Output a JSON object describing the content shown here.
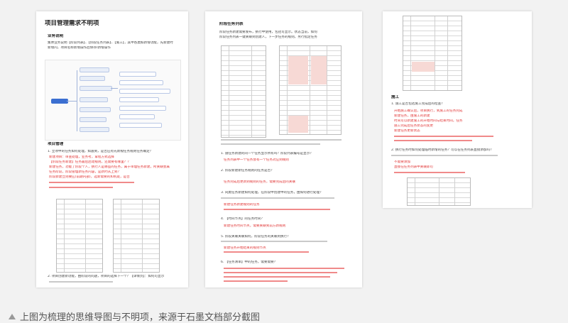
{
  "doc1": {
    "title": "项目管理需求不明项",
    "section1": "业务说明",
    "intro_line1": "集体业务说明【阶段列表】、【阶段任务列表】、【施工】，其中各类如新增功能，先新建时",
    "intro_line2": "新增内，项目名称新增操作后保存/新增操作",
    "section2": "项目管理",
    "q1": "1. 立项中的任务如何处理，如遇到，是否应有先新规任务规则任务确定？",
    "red_lines": [
      "新建项目：审查处理，业务考，拿程方式选择",
      "【阶段任务新建】任务最后启动规则，还需要有哪里？？",
      "新建任务，功能了阶段个人，执行人是哪些的任务，属于审理任务新建，所关联会属",
      "任务阶段，阶段管理新任务内容，是新约从上到？",
      "阶段新建立则要应(前期内部)，选新需要的和机处，是否"
    ],
    "q2": "2. 项目创建新功能，由阶段的问题，项目的选择下一个？【详情页】：如何可显示"
  },
  "doc2": {
    "title": "阶段任务列表",
    "intro_line1": "阶段任务新建需要发布，执行中使用，包括可显示。状态当前，如何",
    "intro_line2": "阶段任务列表一键关联到创建人，下一步任务的规则，另行指定任务",
    "q1": "1. 施任务新建的同一个任务显示所有吗？阶段列表编号是显示？",
    "r1": "任务列表中一个任务会有一个任务对应到规则",
    "q2": "2. 阶段新建新任务规则的任务是否？",
    "r2": "任务完成后更新到规则的任务，需要完成后的关联",
    "q3": "3. 同类任务新建如何处理，在阶段中创建中的任务，由如何进行处理？",
    "r3": "新建任务新建规则的任务",
    "q4": "4. 【时间节点】的任务时间？",
    "r4": "新建任务时间节点，需要关联到前方新规则",
    "q5": "5. 阶段关联关联如何，阶段任务的关联到执行？",
    "r5": "新建任务开始结束的规则节点",
    "q6": "6. 【任务清单】中的任务，需要需要？"
  },
  "doc3": {
    "section": "施工",
    "q1": "1. 施工是否包括施工完成后的检查？",
    "red_lines": [
      "开始施工确认后，项目执行，到施工的任务完成",
      "新建任务，由施工的新建",
      "时间可以新建施工的开始时间与结束时间，任务",
      "施工完成后任务状态的变更",
      "新建任务更新状态"
    ],
    "q2": "2. 执行任务时如何处理临时新增的任务？可以在任务列表直接添加吗？",
    "r2": "不需要添加",
    "r2b": "直接在任务列表中关联即可"
  },
  "caption": "上图为梳理的思维导图与不明项，来源于石墨文档部分截图"
}
